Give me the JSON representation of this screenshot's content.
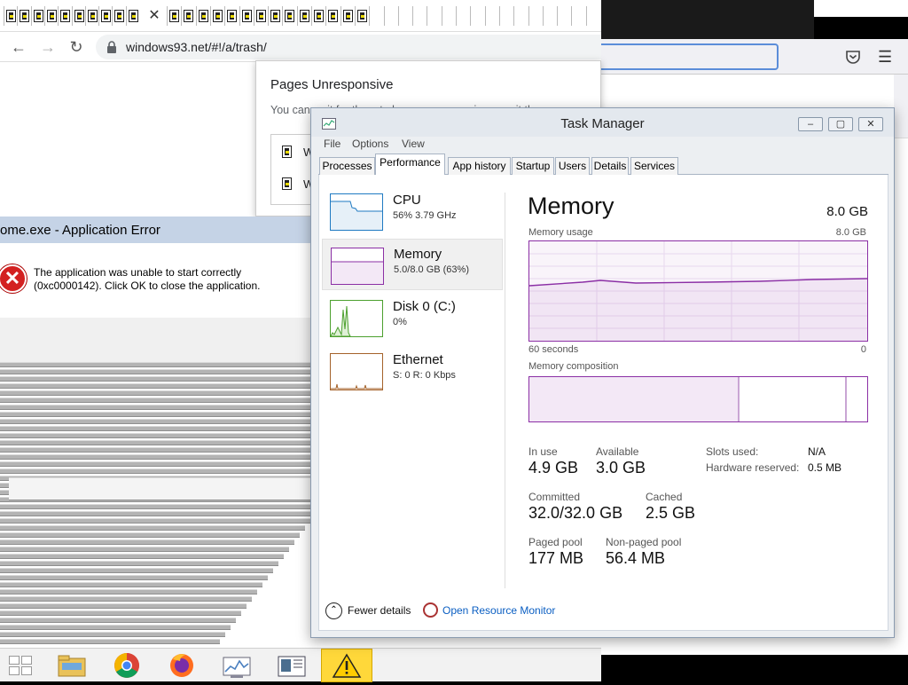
{
  "chrome": {
    "url": "windows93.net/#!/a/trash/",
    "tab_count_left": 10,
    "tab_count_right": 30
  },
  "pages_unresponsive": {
    "title": "Pages Unresponsive",
    "description": "You can wait for them to become responsive or exit them.",
    "items": [
      {
        "label": "W"
      },
      {
        "label": "W"
      }
    ]
  },
  "app_error": {
    "title": "ome.exe - Application Error",
    "message": "The application was unable to start correctly (0xc0000142). Click OK to close the application."
  },
  "taskbar": {
    "items": [
      "start",
      "file-explorer",
      "chrome",
      "firefox",
      "resource-monitor",
      "news-window",
      "warning"
    ],
    "active": "warning"
  },
  "task_manager": {
    "title": "Task Manager",
    "menu": [
      "File",
      "Options",
      "View"
    ],
    "tabs": [
      "Processes",
      "Performance",
      "App history",
      "Startup",
      "Users",
      "Details",
      "Services"
    ],
    "active_tab": "Performance",
    "perf_items": [
      {
        "name": "CPU",
        "sub": "56%  3.79 GHz"
      },
      {
        "name": "Memory",
        "sub": "5.0/8.0 GB (63%)"
      },
      {
        "name": "Disk 0 (C:)",
        "sub": "0%"
      },
      {
        "name": "Ethernet",
        "sub": "S: 0  R: 0 Kbps"
      }
    ],
    "memory": {
      "title": "Memory",
      "total": "8.0 GB",
      "usage_label": "Memory usage",
      "usage_max": "8.0 GB",
      "x_left": "60 seconds",
      "x_right": "0",
      "composition_label": "Memory composition",
      "in_use_label": "In use",
      "in_use": "4.9 GB",
      "available_label": "Available",
      "available": "3.0 GB",
      "committed_label": "Committed",
      "committed": "32.0/32.0 GB",
      "cached_label": "Cached",
      "cached": "2.5 GB",
      "paged_label": "Paged pool",
      "paged": "177 MB",
      "nonpaged_label": "Non-paged pool",
      "nonpaged": "56.4 MB",
      "slots_label": "Slots used:",
      "slots": "N/A",
      "hw_label": "Hardware reserved:",
      "hw": "0.5 MB",
      "usage_fraction": 0.63
    },
    "footer": {
      "fewer_details": "Fewer details",
      "resource_monitor": "Open Resource Monitor"
    }
  },
  "colors": {
    "memory_accent": "#8b2fa5",
    "cpu_accent": "#1f7ac2",
    "disk_accent": "#4ca02e",
    "ethernet_accent": "#a4622a",
    "taskbar_active": "#ffd83a"
  }
}
